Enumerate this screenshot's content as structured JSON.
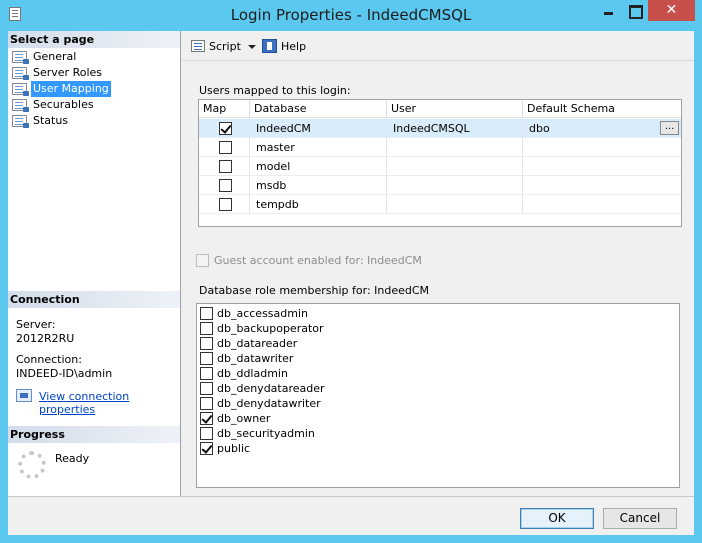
{
  "window": {
    "title": "Login Properties - IndeedCMSQL",
    "close_glyph": "✕"
  },
  "left_pane": {
    "select_page_heading": "Select a page",
    "pages": [
      {
        "label": "General",
        "selected": false
      },
      {
        "label": "Server Roles",
        "selected": false
      },
      {
        "label": "User Mapping",
        "selected": true
      },
      {
        "label": "Securables",
        "selected": false
      },
      {
        "label": "Status",
        "selected": false
      }
    ],
    "connection_heading": "Connection",
    "server_label": "Server:",
    "server_value": "2012R2RU",
    "connection_label": "Connection:",
    "connection_value": "INDEED-ID\\admin",
    "view_connection_link": "View connection properties",
    "progress_heading": "Progress",
    "progress_status": "Ready"
  },
  "toolbar": {
    "script_label": "Script",
    "help_label": "Help"
  },
  "user_mapping": {
    "section_label": "Users mapped to this login:",
    "columns": [
      "Map",
      "Database",
      "User",
      "Default Schema"
    ],
    "rows": [
      {
        "mapped": true,
        "database": "IndeedCM",
        "user": "IndeedCMSQL",
        "default_schema": "dbo",
        "selected": true
      },
      {
        "mapped": false,
        "database": "master",
        "user": "",
        "default_schema": "",
        "selected": false
      },
      {
        "mapped": false,
        "database": "model",
        "user": "",
        "default_schema": "",
        "selected": false
      },
      {
        "mapped": false,
        "database": "msdb",
        "user": "",
        "default_schema": "",
        "selected": false
      },
      {
        "mapped": false,
        "database": "tempdb",
        "user": "",
        "default_schema": "",
        "selected": false
      }
    ],
    "ellipsis_label": "..."
  },
  "guest_account": {
    "label": "Guest account enabled for: IndeedCM",
    "checked": false,
    "enabled": false
  },
  "role_membership": {
    "section_label": "Database role membership for: IndeedCM",
    "roles": [
      {
        "name": "db_accessadmin",
        "checked": false
      },
      {
        "name": "db_backupoperator",
        "checked": false
      },
      {
        "name": "db_datareader",
        "checked": false
      },
      {
        "name": "db_datawriter",
        "checked": false
      },
      {
        "name": "db_ddladmin",
        "checked": false
      },
      {
        "name": "db_denydatareader",
        "checked": false
      },
      {
        "name": "db_denydatawriter",
        "checked": false
      },
      {
        "name": "db_owner",
        "checked": true
      },
      {
        "name": "db_securityadmin",
        "checked": false
      },
      {
        "name": "public",
        "checked": true
      }
    ]
  },
  "buttons": {
    "ok_label": "OK",
    "cancel_label": "Cancel"
  },
  "colors": {
    "window_frame": "#5bc8f0",
    "selection": "#3399ff",
    "link": "#0044cc",
    "close_button": "#c7504a"
  }
}
